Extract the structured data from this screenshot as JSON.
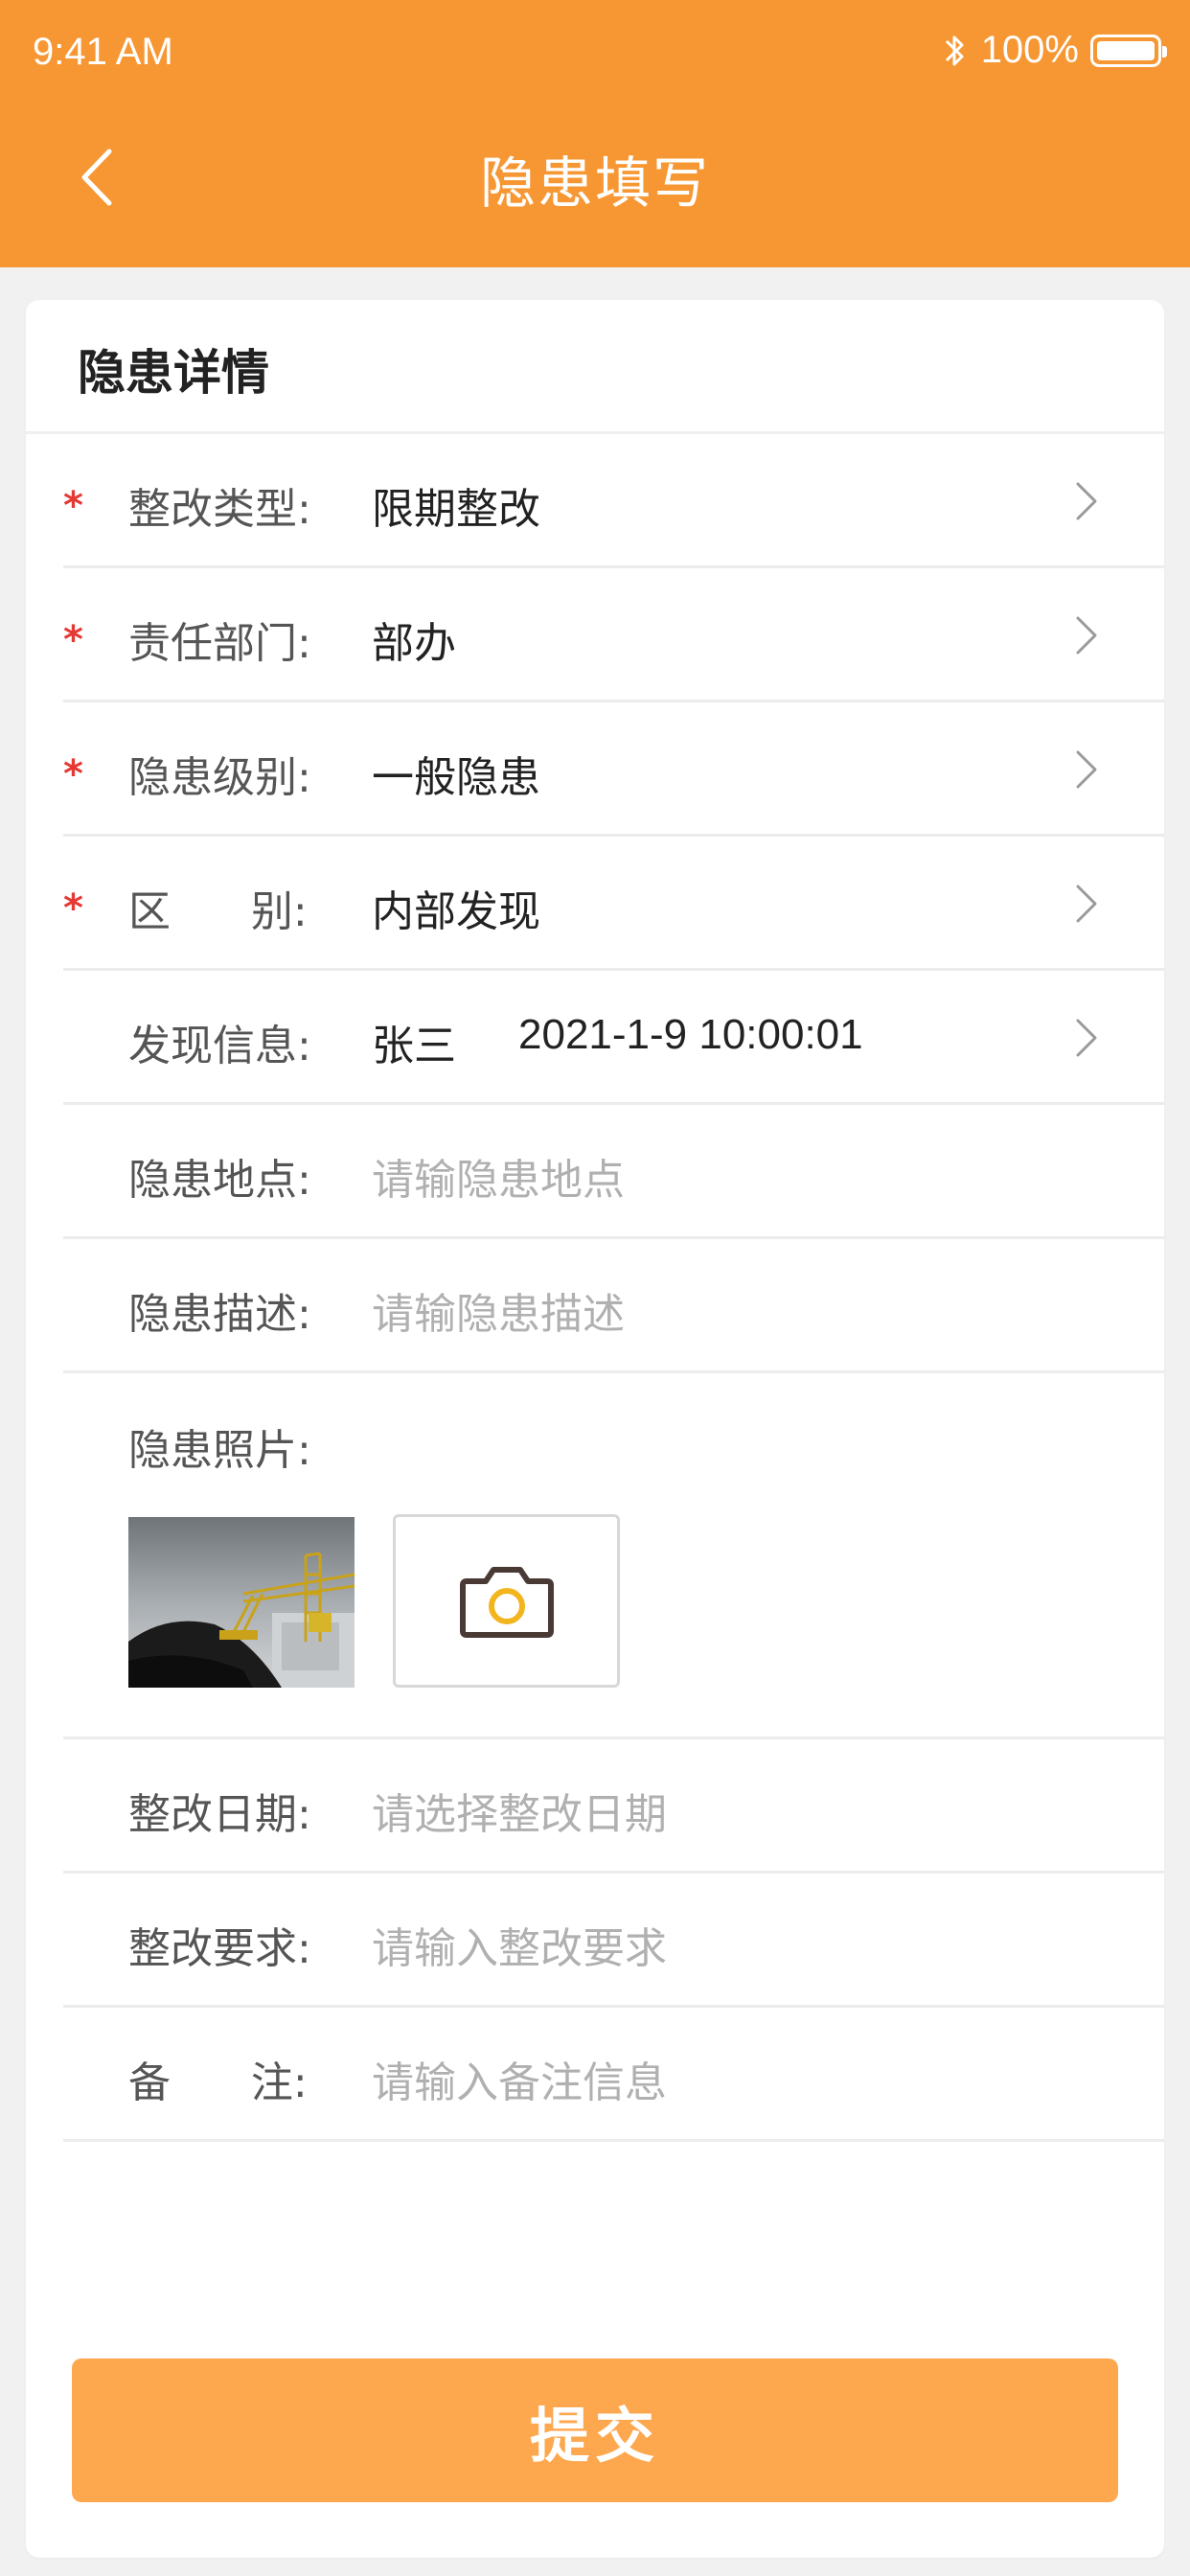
{
  "status_bar": {
    "time": "9:41 AM",
    "battery": "100%"
  },
  "nav": {
    "title": "隐患填写",
    "back_icon": "chevron-left-icon"
  },
  "card": {
    "title": "隐患详情"
  },
  "form": {
    "rectify_type": {
      "label": "整改类型:",
      "value": "限期整改",
      "required": true
    },
    "responsible_dept": {
      "label": "责任部门:",
      "value": "部办",
      "required": true
    },
    "hazard_level": {
      "label": "隐患级别:",
      "value": "一般隐患",
      "required": true
    },
    "category": {
      "label": "区      别:",
      "value": "内部发现",
      "required": true
    },
    "discovery_info": {
      "label": "发现信息:",
      "person": "张三",
      "datetime": "2021-1-9 10:00:01"
    },
    "hazard_location": {
      "label": "隐患地点:",
      "placeholder": "请输隐患地点"
    },
    "hazard_description": {
      "label": "隐患描述:",
      "placeholder": "请输隐患描述"
    },
    "hazard_photo": {
      "label": "隐患照片:"
    },
    "rectify_date": {
      "label": "整改日期:",
      "placeholder": "请选择整改日期"
    },
    "rectify_requirement": {
      "label": "整改要求:",
      "placeholder": "请输入整改要求"
    },
    "remark": {
      "label": "备      注:",
      "placeholder": "请输入备注信息"
    }
  },
  "required_mark": "*",
  "submit": {
    "label": "提交"
  },
  "colors": {
    "header": "#f79733",
    "submit": "#fda84f",
    "required": "#e53935",
    "placeholder": "#b0b0b0"
  }
}
